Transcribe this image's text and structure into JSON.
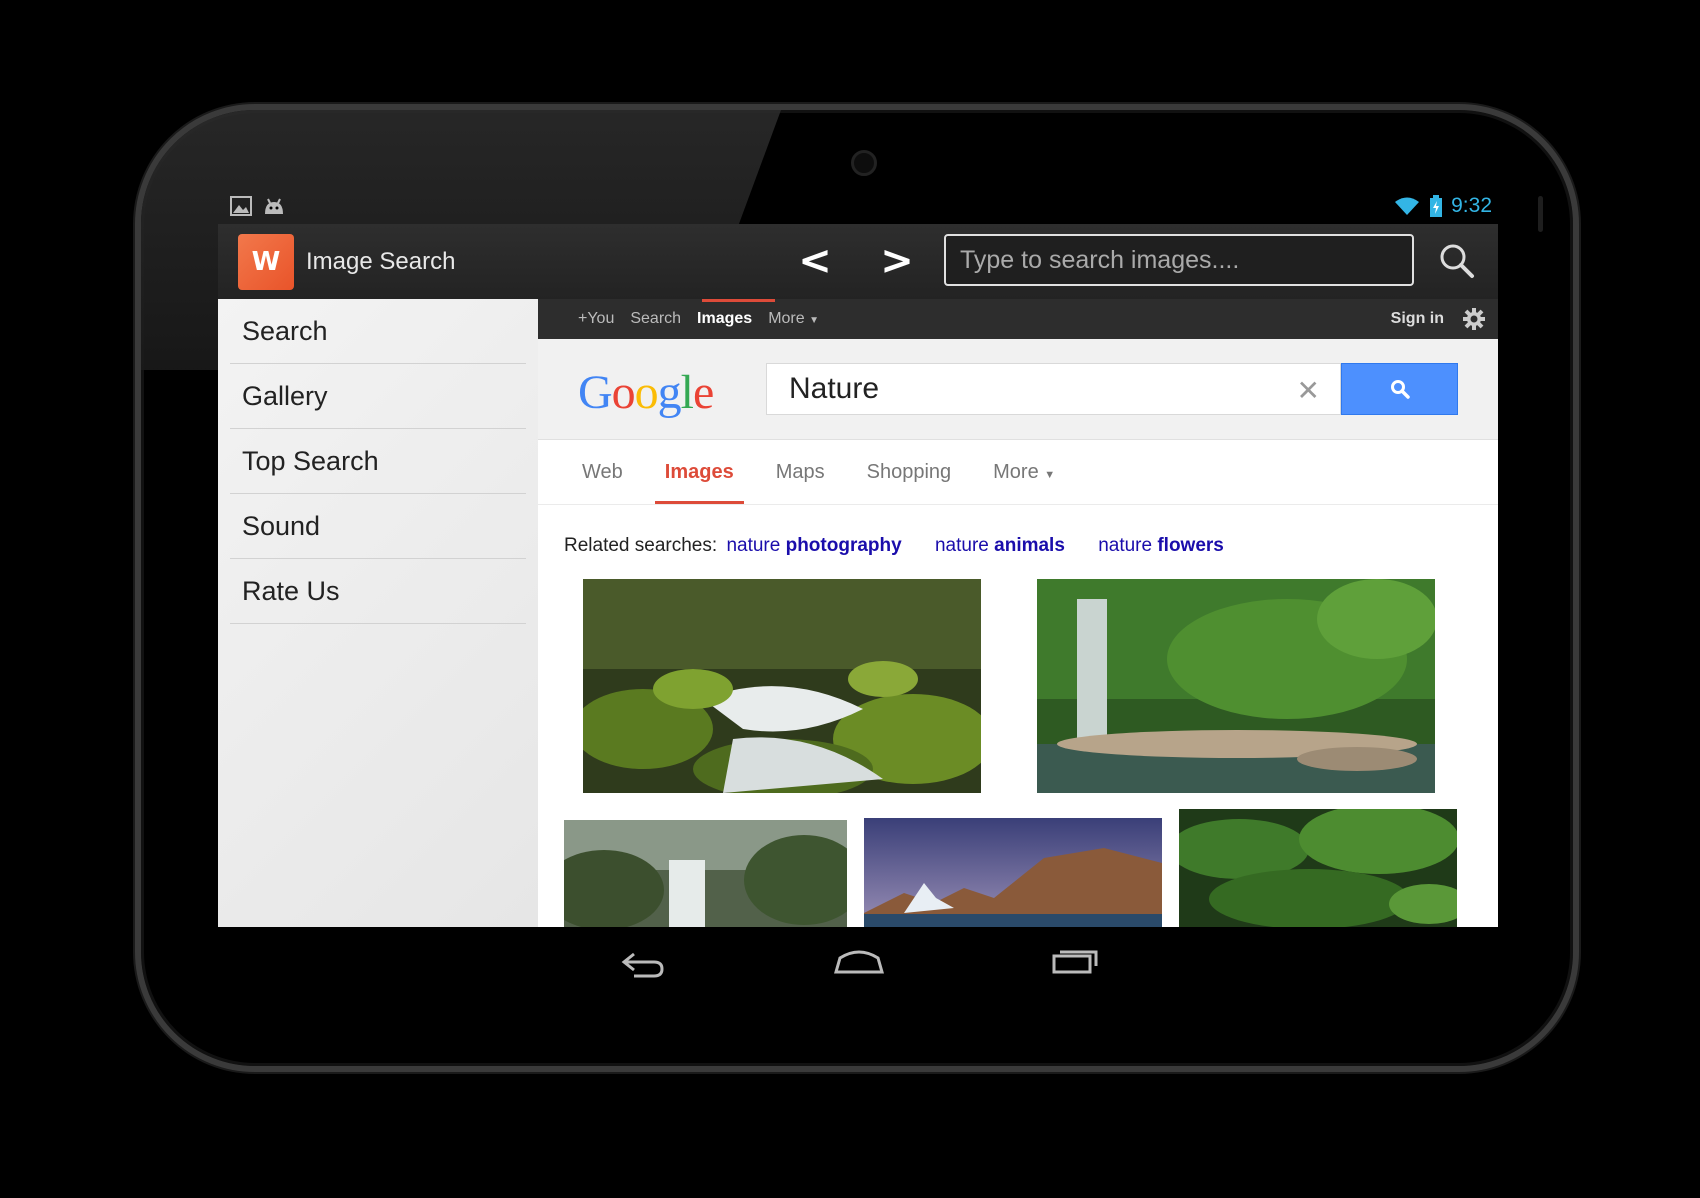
{
  "status": {
    "time": "9:32",
    "left_icons": [
      "picture-icon",
      "android-icon"
    ],
    "right_icons": [
      "wifi-icon",
      "battery-icon"
    ]
  },
  "app": {
    "title": "Image Search",
    "logo_text": "W",
    "back_label": "<",
    "forward_label": ">",
    "search_placeholder": "Type to search images....",
    "search_icon": "magnifier-icon"
  },
  "sidebar": {
    "items": [
      {
        "label": "Search"
      },
      {
        "label": "Gallery"
      },
      {
        "label": "Top Search"
      },
      {
        "label": "Sound"
      },
      {
        "label": "Rate Us"
      }
    ]
  },
  "google": {
    "bar_links": [
      "+You",
      "Search",
      "Images",
      "More"
    ],
    "active_bar_link": "Images",
    "sign_in": "Sign in",
    "logo": "Google",
    "query": "Nature",
    "tabs": [
      "Web",
      "Images",
      "Maps",
      "Shopping",
      "More"
    ],
    "active_tab": "Images",
    "related_label": "Related searches:",
    "related": [
      {
        "plain": "nature",
        "bold": "photography"
      },
      {
        "plain": "nature",
        "bold": "animals"
      },
      {
        "plain": "nature",
        "bold": "flowers"
      }
    ],
    "colors": {
      "blue": "#4d90fe",
      "red": "#dd4b39",
      "link": "#1a0dab"
    }
  },
  "images": [
    {
      "name": "forest-stream-image"
    },
    {
      "name": "waterfall-jungle-image"
    },
    {
      "name": "misty-waterfall-image"
    },
    {
      "name": "mountain-lake-image"
    },
    {
      "name": "fern-forest-image"
    }
  ],
  "navbar": [
    "back-nav-icon",
    "home-nav-icon",
    "recents-nav-icon"
  ]
}
